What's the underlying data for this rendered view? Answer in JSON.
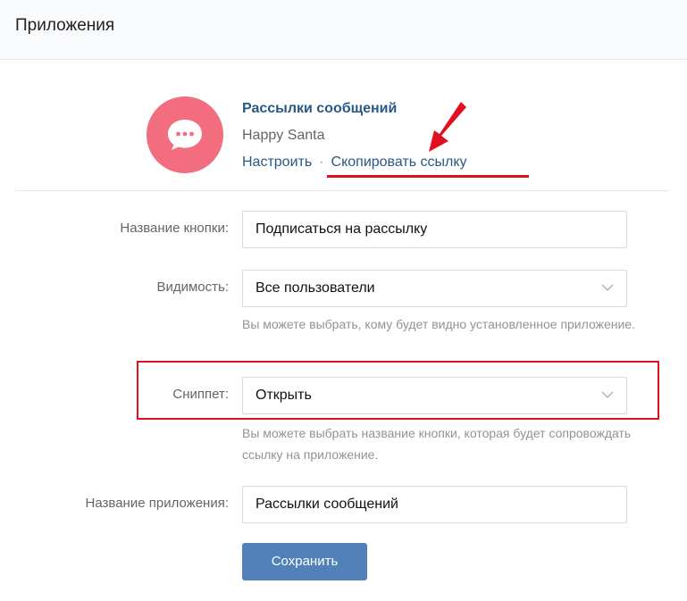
{
  "header": {
    "title": "Приложения"
  },
  "app": {
    "name": "Рассылки сообщений",
    "author": "Happy Santa",
    "configure_link": "Настроить",
    "separator": "·",
    "copy_link": "Скопировать ссылку"
  },
  "form": {
    "button_name": {
      "label": "Название кнопки:",
      "value": "Подписаться на рассылку"
    },
    "visibility": {
      "label": "Видимость:",
      "value": "Все пользователи",
      "hint": "Вы можете выбрать, кому будет видно установленное приложение."
    },
    "snippet": {
      "label": "Сниппет:",
      "value": "Открыть",
      "hint": "Вы можете выбрать название кнопки, которая будет сопровождать ссылку на приложение."
    },
    "app_name": {
      "label": "Название приложения:",
      "value": "Рассылки сообщений"
    },
    "save_label": "Сохранить"
  },
  "colors": {
    "avatar_bg": "#f26d7d",
    "link": "#2a5885",
    "button_bg": "#5181b8",
    "annotation_red": "#e0101e"
  },
  "icons": {
    "avatar": "message-bubble-icon",
    "select_caret": "chevron-down-icon",
    "annotation_arrow": "red-arrow-icon"
  }
}
